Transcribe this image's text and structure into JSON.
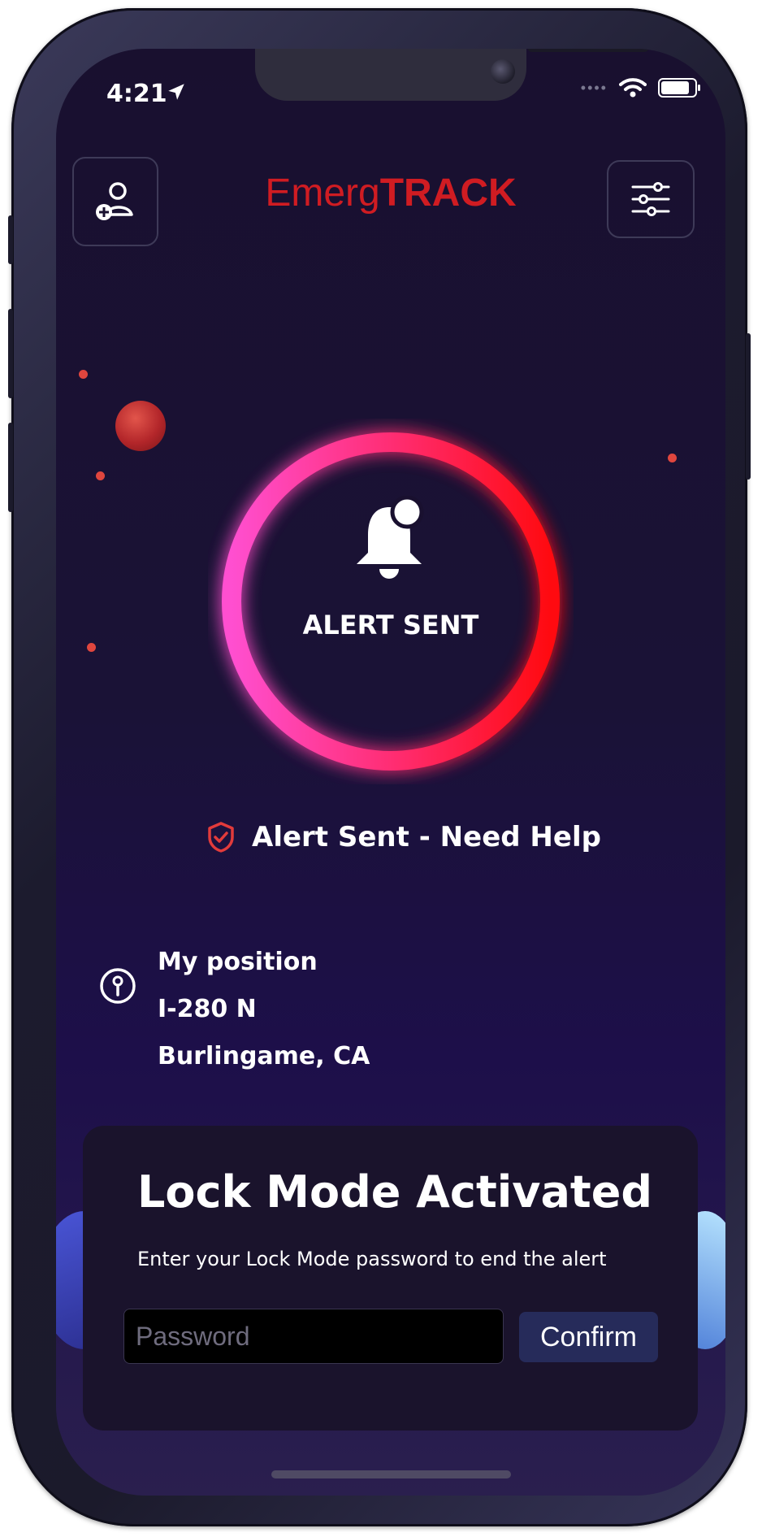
{
  "status_bar": {
    "time": "4:21"
  },
  "header": {
    "brand_light": "Emerg",
    "brand_bold": "TRACK"
  },
  "alert": {
    "button_label": "ALERT SENT",
    "status_text": "Alert Sent - Need Help"
  },
  "position": {
    "title": "My position",
    "road": "I-280 N",
    "city": "Burlingame, CA"
  },
  "lock_card": {
    "title": "Lock Mode Activated",
    "subtitle": "Enter your Lock Mode password to end the alert",
    "password_placeholder": "Password",
    "confirm_label": "Confirm"
  },
  "colors": {
    "accent_red": "#d01c22",
    "ring_pink": "#ff4fd0",
    "ring_red": "#ff1a1a",
    "background": "#1a1236"
  }
}
